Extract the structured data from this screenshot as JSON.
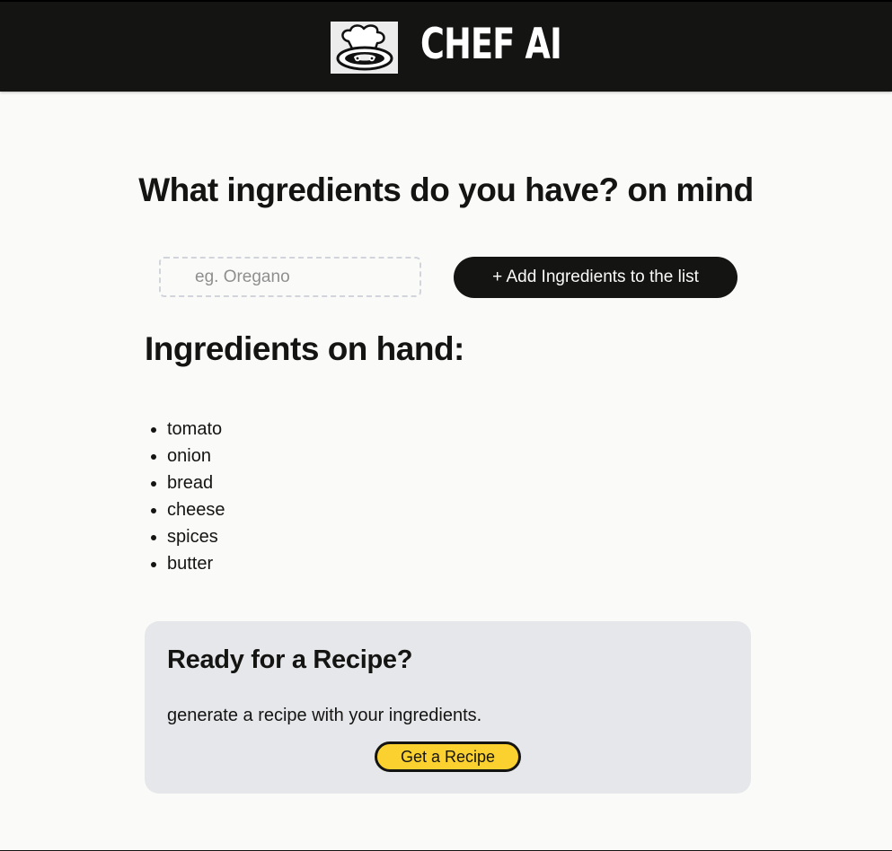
{
  "header": {
    "brand": "CHEF AI",
    "logo_icon": "chef-hat-icon"
  },
  "main": {
    "question": "What ingredients do you have? on mind",
    "input": {
      "placeholder": "eg. Oregano",
      "value": ""
    },
    "add_button_label": "+ Add Ingredients to the list",
    "on_hand_title": "Ingredients on hand:",
    "ingredients": [
      "tomato",
      "onion",
      "bread",
      "cheese",
      "spices",
      "butter"
    ]
  },
  "recipe_card": {
    "title": "Ready for a Recipe?",
    "text": "generate a recipe with your ingredients.",
    "button_label": "Get a Recipe"
  },
  "colors": {
    "header_bg": "#141413",
    "page_bg": "#fafaf8",
    "card_bg": "#e6e7ea",
    "accent_button": "#fbd130"
  }
}
